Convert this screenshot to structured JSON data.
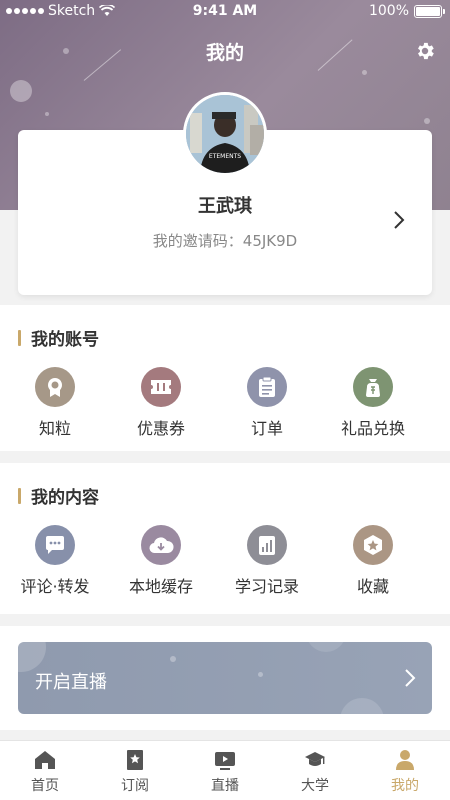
{
  "status_bar": {
    "carrier": "Sketch",
    "time": "9:41 AM",
    "battery": "100%"
  },
  "nav": {
    "title": "我的",
    "settings_icon": "gear-icon"
  },
  "profile": {
    "name": "王武琪",
    "invite_label": "我的邀请码：",
    "invite_code": "45JK9D",
    "avatar_text": "ETEMENTS"
  },
  "account": {
    "title": "我的账号",
    "items": [
      {
        "label": "知粒",
        "icon": "badge-icon",
        "color": "#a69888"
      },
      {
        "label": "优惠券",
        "icon": "ticket-icon",
        "color": "#a47a7e"
      },
      {
        "label": "订单",
        "icon": "clipboard-icon",
        "color": "#8f93ab"
      },
      {
        "label": "礼品兑换",
        "icon": "gift-bag-icon",
        "color": "#7e9472"
      }
    ]
  },
  "content": {
    "title": "我的内容",
    "items": [
      {
        "label": "评论·转发",
        "icon": "comment-icon",
        "color": "#8790aa"
      },
      {
        "label": "本地缓存",
        "icon": "cloud-download-icon",
        "color": "#9a8aa0"
      },
      {
        "label": "学习记录",
        "icon": "chart-icon",
        "color": "#8e8e96"
      },
      {
        "label": "收藏",
        "icon": "star-icon",
        "color": "#ab9684"
      }
    ]
  },
  "live": {
    "label": "开启直播"
  },
  "tabbar": {
    "items": [
      {
        "label": "首页",
        "icon": "home-icon"
      },
      {
        "label": "订阅",
        "icon": "bookmark-icon"
      },
      {
        "label": "直播",
        "icon": "play-icon"
      },
      {
        "label": "大学",
        "icon": "graduation-cap-icon"
      },
      {
        "label": "我的",
        "icon": "user-icon",
        "active": true
      }
    ],
    "active_color": "#c9a86a"
  }
}
